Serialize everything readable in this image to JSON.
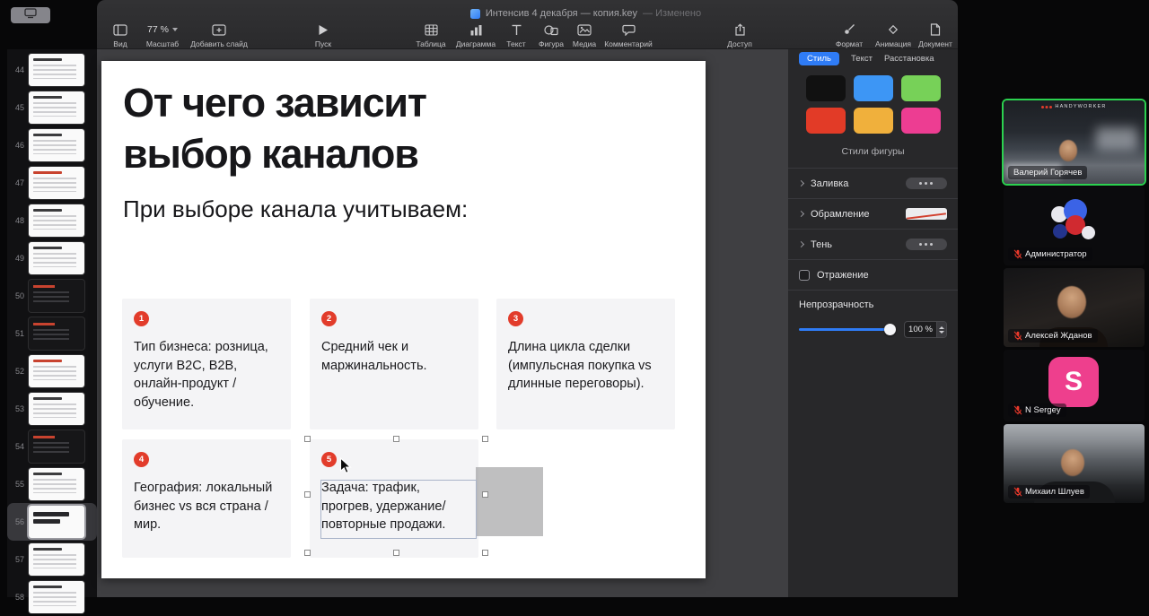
{
  "window": {
    "title": "Интенсив 4 декабря — копия.key",
    "modified": "— Изменено"
  },
  "toolbar": {
    "view": "Вид",
    "zoom_value": "77 %",
    "zoom_label": "Масштаб",
    "add_slide": "Добавить слайд",
    "play": "Пуск",
    "table": "Таблица",
    "chart": "Диаграмма",
    "text": "Текст",
    "shape": "Фигура",
    "media": "Медиа",
    "comment": "Комментарий",
    "share": "Доступ",
    "format": "Формат",
    "animate": "Анимация",
    "document": "Документ"
  },
  "navigator": {
    "selected_slide": "56",
    "slides": [
      {
        "num": "44",
        "variant": "light"
      },
      {
        "num": "45",
        "variant": "light"
      },
      {
        "num": "46",
        "variant": "light"
      },
      {
        "num": "47",
        "variant": "light"
      },
      {
        "num": "48",
        "variant": "light"
      },
      {
        "num": "49",
        "variant": "light"
      },
      {
        "num": "50",
        "variant": "dark"
      },
      {
        "num": "51",
        "variant": "dark"
      },
      {
        "num": "52",
        "variant": "light-red"
      },
      {
        "num": "53",
        "variant": "light"
      },
      {
        "num": "54",
        "variant": "dark"
      },
      {
        "num": "55",
        "variant": "light"
      },
      {
        "num": "56",
        "variant": "title-selected"
      },
      {
        "num": "57",
        "variant": "light"
      },
      {
        "num": "58",
        "variant": "light"
      }
    ]
  },
  "slide": {
    "title": "От чего зависит\nвыбор каналов",
    "subtitle": "При выборе канала учитываем:",
    "cards": [
      {
        "num": "1",
        "text": "Тип бизнеса: розница, услуги B2C, B2B, онлайн-продукт / обучение."
      },
      {
        "num": "2",
        "text": "Средний чек и маржинальность."
      },
      {
        "num": "3",
        "text": "Длина цикла сделки (импульсная покупка vs длинные переговоры)."
      },
      {
        "num": "4",
        "text": "География: локальный бизнес vs вся страна / мир."
      },
      {
        "num": "5",
        "text": "Задача: трафик, прогрев, удержание/повторные продажи."
      }
    ]
  },
  "inspector": {
    "tabs": {
      "style": "Стиль",
      "text": "Текст",
      "arrange": "Расстановка"
    },
    "active_tab": "Стиль",
    "shape_styles": "Стили фигуры",
    "fill": "Заливка",
    "border": "Обрамление",
    "shadow": "Тень",
    "reflection": "Отражение",
    "opacity": "Непрозрачность",
    "opacity_value": "100 %",
    "swatches": [
      "#111111",
      "#3d96f5",
      "#77d158",
      "#e23b27",
      "#f0b03c",
      "#ed3d92"
    ]
  },
  "participants": [
    {
      "name": "Валерий Горячев",
      "watermark": "HANDYWORKER",
      "active_speaker": true
    },
    {
      "name": "Администратор",
      "muted": true
    },
    {
      "name": "Алексей Жданов",
      "muted": true
    },
    {
      "name": "N Sergey",
      "initial": "S",
      "muted": true
    },
    {
      "name": "Михаил Шлуев",
      "muted": true
    }
  ],
  "colors": {
    "accent_blue": "#2f7cf6",
    "keynote_red": "#e23c2b",
    "active_speaker_green": "#2bd14f",
    "muted_mic_red": "#e8392b",
    "card_gray": "#f4f4f6"
  }
}
